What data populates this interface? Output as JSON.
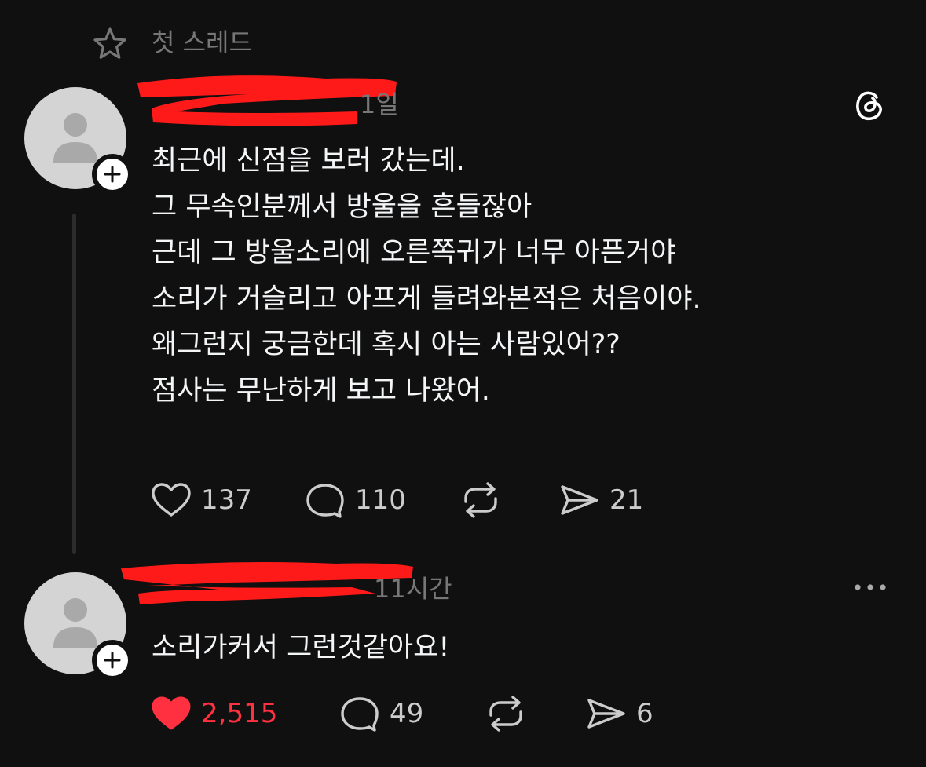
{
  "header": {
    "label": "첫 스레드",
    "icon": "star-icon"
  },
  "post": {
    "username": "",
    "time": "1일",
    "lines": [
      "최근에 신점을 보러 갔는데.",
      "그 무속인분께서 방울을 흔들잖아",
      "근데 그 방울소리에 오른쪽귀가 너무 아픈거야",
      "소리가 거슬리고 아프게 들려와본적은 처음이야.",
      "왜그런지 궁금한데 혹시 아는 사람있어??",
      "점사는 무난하게 보고 나왔어."
    ],
    "likes": "137",
    "comments": "110",
    "shares": "21"
  },
  "reply": {
    "username": "",
    "time": "11시간",
    "text": "소리가커서 그런것같아요!",
    "likes": "2,515",
    "comments": "49",
    "shares": "6",
    "liked": true
  },
  "colors": {
    "background": "#101010",
    "text": "#f3f5f7",
    "muted": "#777777",
    "liked_red": "#ff3040",
    "redaction": "#ff1a1a"
  }
}
